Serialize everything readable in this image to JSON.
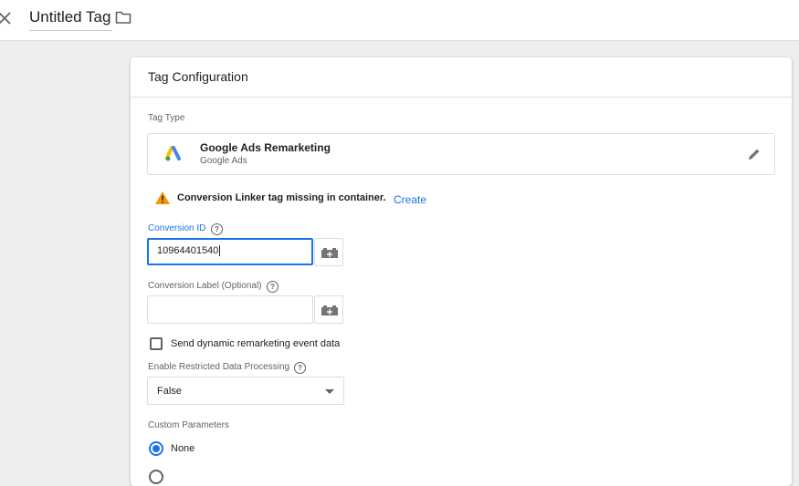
{
  "header": {
    "tag_name": "Untitled Tag",
    "close_icon": "close-icon",
    "folder_icon": "folder-icon"
  },
  "card": {
    "title": "Tag Configuration",
    "tag_type_label": "Tag Type",
    "tag_type": {
      "name": "Google Ads Remarketing",
      "vendor": "Google Ads",
      "logo": "google-ads-logo",
      "edit_icon": "pencil-icon"
    },
    "warning": {
      "icon": "warning-icon",
      "text": "Conversion Linker tag missing in container.",
      "action": "Create"
    },
    "conversion_id": {
      "label": "Conversion ID",
      "help": "?",
      "value": "10964401540",
      "variable_icon": "variable-picker-icon"
    },
    "conversion_label": {
      "label": "Conversion Label (Optional)",
      "help": "?",
      "value": "",
      "variable_icon": "variable-picker-icon"
    },
    "dynamic_remarketing": {
      "label": "Send dynamic remarketing event data",
      "checked": false
    },
    "restricted_data_processing": {
      "label": "Enable Restricted Data Processing",
      "help": "?",
      "selected": "False"
    },
    "custom_parameters": {
      "label": "Custom Parameters",
      "options": [
        {
          "label": "None",
          "checked": true
        }
      ]
    }
  },
  "colors": {
    "accent": "#1a73e8",
    "warning": "#f29900",
    "background": "#eeeeee"
  }
}
